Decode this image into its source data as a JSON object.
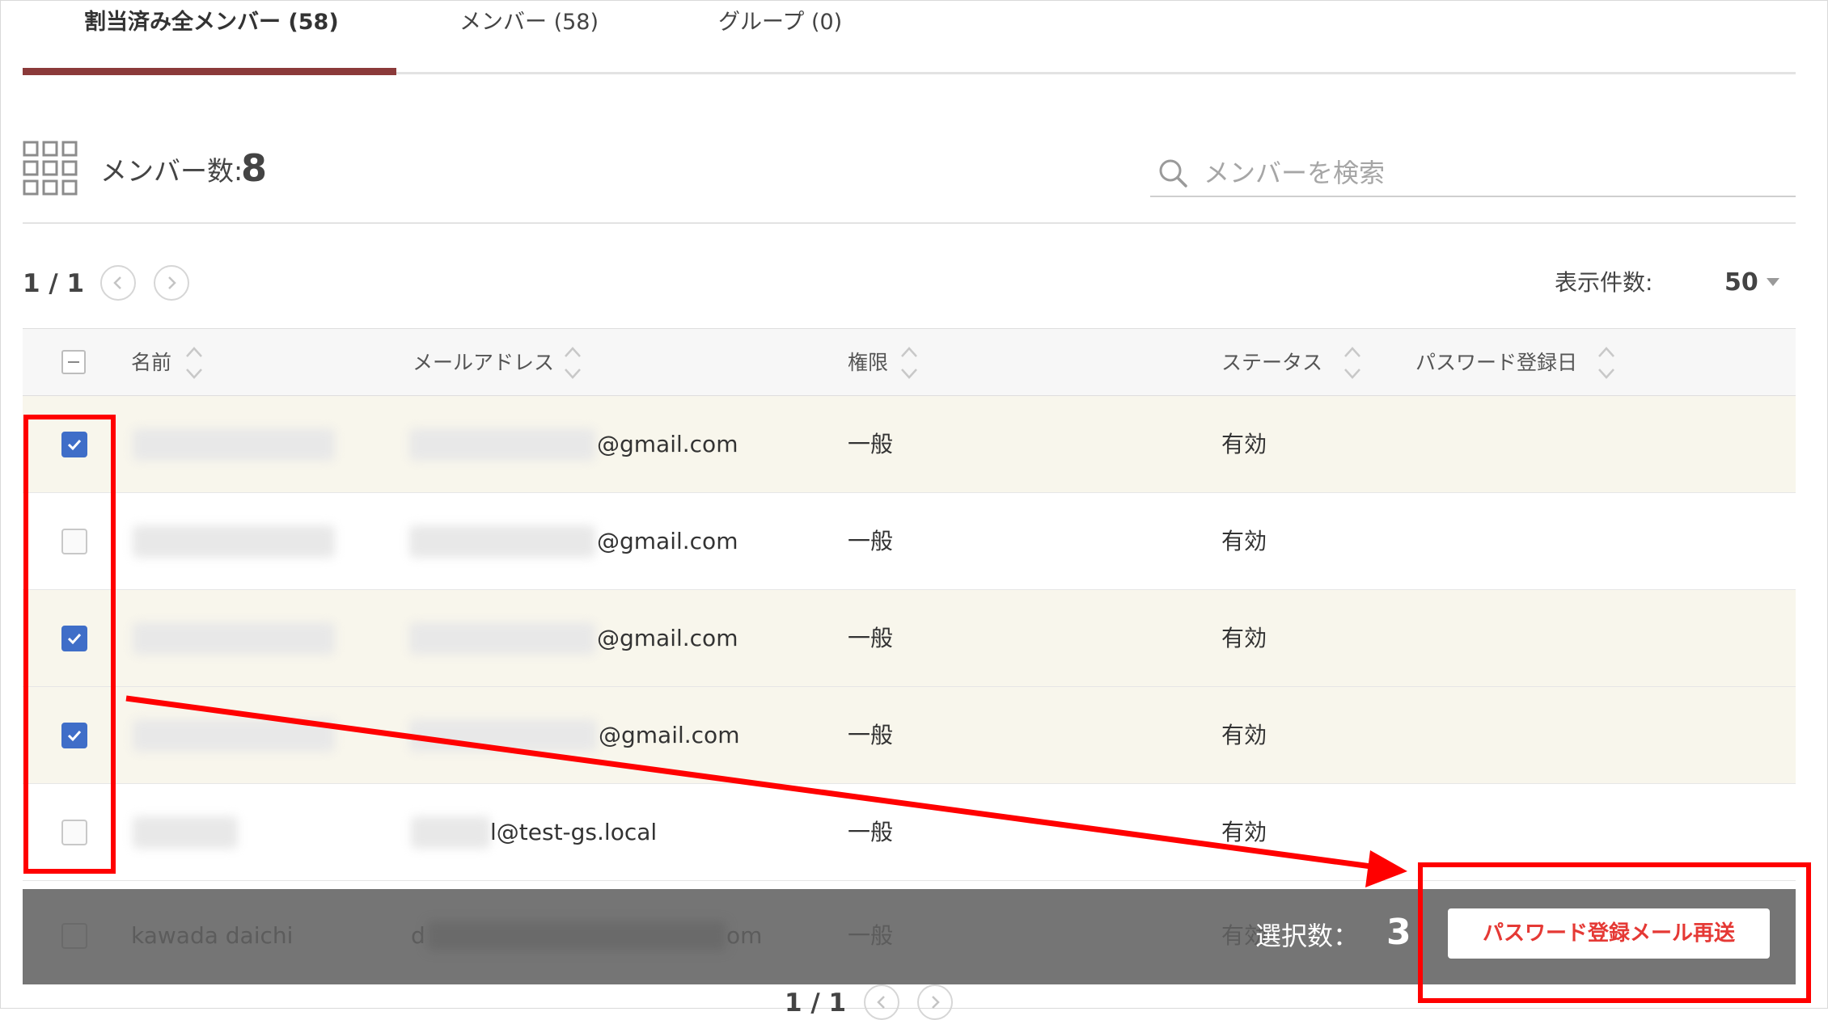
{
  "tabs": [
    {
      "label": "割当済み全メンバー (58)",
      "active": true
    },
    {
      "label": "メンバー (58)",
      "active": false
    },
    {
      "label": "グループ (0)",
      "active": false
    }
  ],
  "summary": {
    "member_count_label": "メンバー数:",
    "member_count_value": "8"
  },
  "search": {
    "placeholder": "メンバーを検索",
    "value": ""
  },
  "pager": {
    "page_text": "1 / 1",
    "per_page_label": "表示件数:",
    "per_page_value": "50"
  },
  "table": {
    "columns": [
      "名前",
      "メールアドレス",
      "権限",
      "ステータス",
      "パスワード登録日"
    ],
    "rows": [
      {
        "checked": true,
        "email_suffix": "@gmail.com",
        "role": "一般",
        "status": "有効"
      },
      {
        "checked": false,
        "email_suffix": "@gmail.com",
        "role": "一般",
        "status": "有効"
      },
      {
        "checked": true,
        "email_suffix": "@gmail.com",
        "role": "一般",
        "status": "有効"
      },
      {
        "checked": true,
        "email_suffix": "@gmail.com",
        "role": "一般",
        "status": "有効"
      },
      {
        "checked": false,
        "email_suffix": "l@test-gs.local",
        "role": "一般",
        "status": "有効"
      }
    ],
    "partial_row": {
      "name": "kawada daichi",
      "email_start": "d",
      "email_end": "om",
      "role": "一般",
      "status": "有効"
    }
  },
  "action_bar": {
    "selected_label": "選択数：",
    "selected_count": "3",
    "resend_button_label": "パスワード登録メール再送"
  },
  "bottom_pager": {
    "page_text": "1 / 1"
  },
  "colors": {
    "accent_tab": "#8b3a3a",
    "checkbox_checked": "#3f6ec8",
    "selected_row": "#f8f6ec",
    "action_bar": "#757575",
    "danger_text": "#e53935",
    "annotation": "#ff0000"
  }
}
